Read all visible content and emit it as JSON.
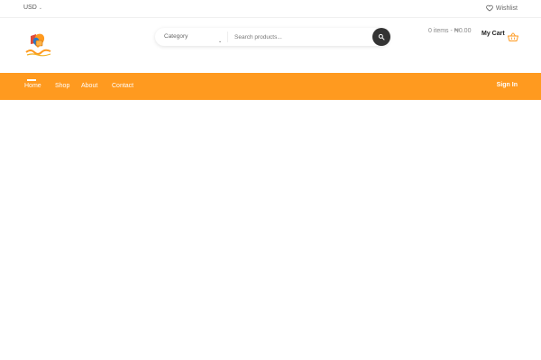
{
  "topbar": {
    "currency": "USD",
    "wishlist_label": "Wishlist"
  },
  "search": {
    "category_label": "Category",
    "placeholder": "Search products..."
  },
  "cart": {
    "summary": "0 items - ₦0.00",
    "label": "My Cart"
  },
  "nav": {
    "items": [
      {
        "label": "Home"
      },
      {
        "label": "Shop"
      },
      {
        "label": "About"
      },
      {
        "label": "Contact"
      }
    ],
    "signin_label": "Sign In"
  },
  "colors": {
    "accent": "#ff9a1f",
    "search_button": "#333333"
  },
  "icons": {
    "wishlist": "heart-icon",
    "search": "search-icon",
    "cart": "basket-icon",
    "currency_dropdown": "chevron-down-icon",
    "category_dropdown": "chevron-down-icon"
  }
}
